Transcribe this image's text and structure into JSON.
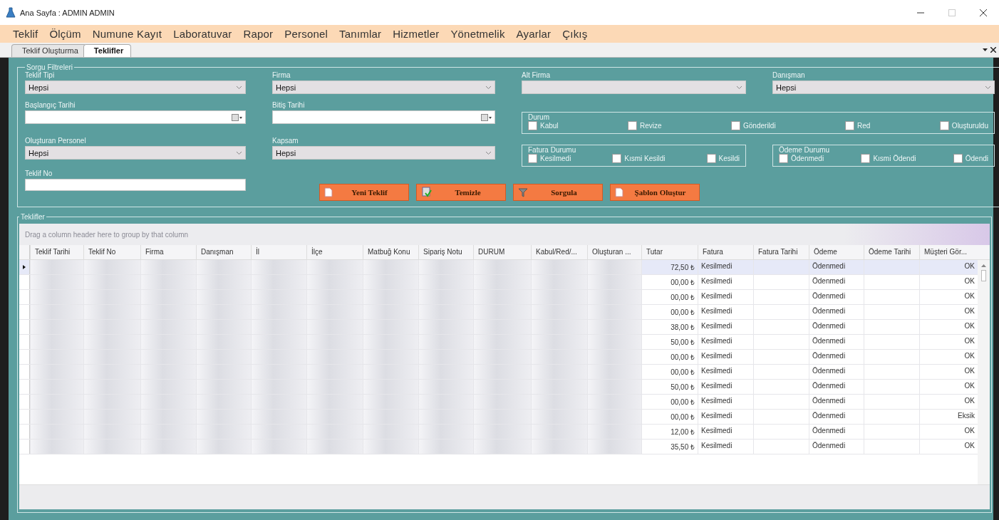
{
  "window": {
    "title": "Ana Sayfa : ADMIN ADMIN"
  },
  "menu": [
    "Teklif",
    "Ölçüm",
    "Numune Kayıt",
    "Laboratuvar",
    "Rapor",
    "Personel",
    "Tanımlar",
    "Hizmetler",
    "Yönetmelik",
    "Ayarlar",
    "Çıkış"
  ],
  "tabs": [
    {
      "label": "Teklif Oluşturma",
      "selected": false
    },
    {
      "label": "Teklifler",
      "selected": true
    }
  ],
  "filters": {
    "title": "Sorgu Filtreleri",
    "fields": [
      {
        "kind": "dropdown",
        "label": "Teklif Tipi",
        "value": "Hepsi"
      },
      {
        "kind": "dropdown",
        "label": "Firma",
        "value": "Hepsi"
      },
      {
        "kind": "dropdown",
        "label": "Alt Firma"
      },
      {
        "kind": "dropdown",
        "label": "Danışman",
        "value": "Hepsi"
      },
      {
        "kind": "date",
        "label": "Başlangıç Tarihi"
      },
      {
        "kind": "date",
        "label": "Bitiş Tarihi"
      },
      {
        "kind": "dropdown",
        "label": "Oluşturan Personel",
        "value": "Hepsi"
      },
      {
        "kind": "dropdown",
        "label": "Kapsam",
        "value": "Hepsi"
      },
      {
        "kind": "text",
        "label": "Teklif No"
      }
    ],
    "groups": [
      {
        "title": "Durum",
        "options": [
          {
            "label": "Kabul",
            "checked": false
          },
          {
            "label": "Revize",
            "checked": false
          },
          {
            "label": "Gönderildi",
            "checked": false
          },
          {
            "label": "Red",
            "checked": false
          },
          {
            "label": "Oluşturuldu",
            "checked": false
          }
        ]
      },
      {
        "title": "Fatura Durumu",
        "options": [
          {
            "label": "Kesilmedi",
            "checked": false
          },
          {
            "label": "Kısmi Kesildi",
            "checked": false
          },
          {
            "label": "Kesildi",
            "checked": false
          }
        ]
      },
      {
        "title": "Ödeme Durumu",
        "options": [
          {
            "label": "Ödenmedi",
            "checked": false
          },
          {
            "label": "Kısmi Ödendi",
            "checked": false
          },
          {
            "label": "Ödendi",
            "checked": false
          }
        ]
      }
    ],
    "buttons": [
      {
        "label": "Yeni Teklif",
        "kind": "new"
      },
      {
        "label": "Temizle",
        "kind": "clear"
      },
      {
        "label": "Sorgula",
        "kind": "filter"
      },
      {
        "label": "Şablon Oluştur",
        "kind": "template"
      }
    ]
  },
  "table": {
    "title": "Teklifler",
    "group_hint": "Drag a column header here to group by that column",
    "columns": [
      "Teklif Tarihi",
      "Teklif No",
      "Firma",
      "Danışman",
      "İl",
      "İlçe",
      "Matbuğ Konu",
      "Sipariş Notu",
      "DURUM",
      "Kabul/Red/...",
      "Oluşturan ...",
      "Tutar",
      "Fatura",
      "Fatura Tarihi",
      "Ödeme",
      "Ödeme Tarihi",
      "Müşteri Gör..."
    ],
    "rows": [
      {
        "tutar": "72,50 ₺",
        "fatura": "Kesilmedi",
        "odeme": "Ödenmedi",
        "musteri": "OK",
        "selected": true
      },
      {
        "tutar": "00,00 ₺",
        "fatura": "Kesilmedi",
        "odeme": "Ödenmedi",
        "musteri": "OK",
        "selected": false
      },
      {
        "tutar": "00,00 ₺",
        "fatura": "Kesilmedi",
        "odeme": "Ödenmedi",
        "musteri": "OK",
        "selected": false
      },
      {
        "tutar": "00,00 ₺",
        "fatura": "Kesilmedi",
        "odeme": "Ödenmedi",
        "musteri": "OK",
        "selected": false
      },
      {
        "tutar": "38,00 ₺",
        "fatura": "Kesilmedi",
        "odeme": "Ödenmedi",
        "musteri": "OK",
        "selected": false
      },
      {
        "tutar": "50,00 ₺",
        "fatura": "Kesilmedi",
        "odeme": "Ödenmedi",
        "musteri": "OK",
        "selected": false
      },
      {
        "tutar": "00,00 ₺",
        "fatura": "Kesilmedi",
        "odeme": "Ödenmedi",
        "musteri": "OK",
        "selected": false
      },
      {
        "tutar": "00,00 ₺",
        "fatura": "Kesilmedi",
        "odeme": "Ödenmedi",
        "musteri": "OK",
        "selected": false
      },
      {
        "tutar": "50,00 ₺",
        "fatura": "Kesilmedi",
        "odeme": "Ödenmedi",
        "musteri": "OK",
        "selected": false
      },
      {
        "tutar": "00,00 ₺",
        "fatura": "Kesilmedi",
        "odeme": "Ödenmedi",
        "musteri": "OK",
        "selected": false
      },
      {
        "tutar": "00,00 ₺",
        "fatura": "Kesilmedi",
        "odeme": "Ödenmedi",
        "musteri": "Eksik",
        "selected": false
      },
      {
        "tutar": "12,00 ₺",
        "fatura": "Kesilmedi",
        "odeme": "Ödenmedi",
        "musteri": "OK",
        "selected": false
      },
      {
        "tutar": "35,50 ₺",
        "fatura": "Kesilmedi",
        "odeme": "Ödenmedi",
        "musteri": "OK",
        "selected": false
      }
    ]
  }
}
